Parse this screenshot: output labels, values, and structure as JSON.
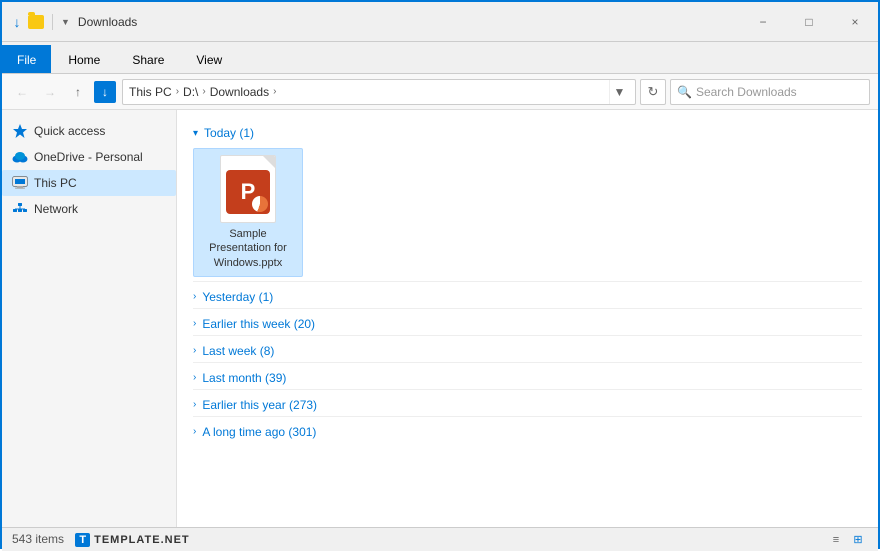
{
  "titlebar": {
    "title": "Downloads",
    "minimize_label": "−",
    "maximize_label": "□",
    "close_label": "×"
  },
  "ribbon": {
    "tabs": [
      {
        "id": "file",
        "label": "File",
        "active": true
      },
      {
        "id": "home",
        "label": "Home",
        "active": false
      },
      {
        "id": "share",
        "label": "Share",
        "active": false
      },
      {
        "id": "view",
        "label": "View",
        "active": false
      }
    ]
  },
  "addressbar": {
    "path_segments": [
      "This PC",
      "D:\\",
      "Downloads"
    ],
    "search_placeholder": "Search Downloads",
    "refresh_unicode": "↻"
  },
  "sidebar": {
    "items": [
      {
        "id": "quick-access",
        "label": "Quick access",
        "icon": "star"
      },
      {
        "id": "onedrive",
        "label": "OneDrive - Personal",
        "icon": "cloud"
      },
      {
        "id": "this-pc",
        "label": "This PC",
        "icon": "pc",
        "active": true
      },
      {
        "id": "network",
        "label": "Network",
        "icon": "network"
      }
    ]
  },
  "content": {
    "groups": [
      {
        "id": "today",
        "label": "Today (1)",
        "expanded": true
      },
      {
        "id": "yesterday",
        "label": "Yesterday (1)",
        "expanded": false
      },
      {
        "id": "earlier-week",
        "label": "Earlier this week (20)",
        "expanded": false
      },
      {
        "id": "last-week",
        "label": "Last week (8)",
        "expanded": false
      },
      {
        "id": "last-month",
        "label": "Last month (39)",
        "expanded": false
      },
      {
        "id": "earlier-year",
        "label": "Earlier this year (273)",
        "expanded": false
      },
      {
        "id": "long-ago",
        "label": "A long time ago (301)",
        "expanded": false
      }
    ],
    "today_file": {
      "name": "Sample Presentation for Windows.pptx",
      "display_name": "Sample\nPresentation for\nWindows.pptx"
    }
  },
  "statusbar": {
    "item_count": "543 items"
  }
}
